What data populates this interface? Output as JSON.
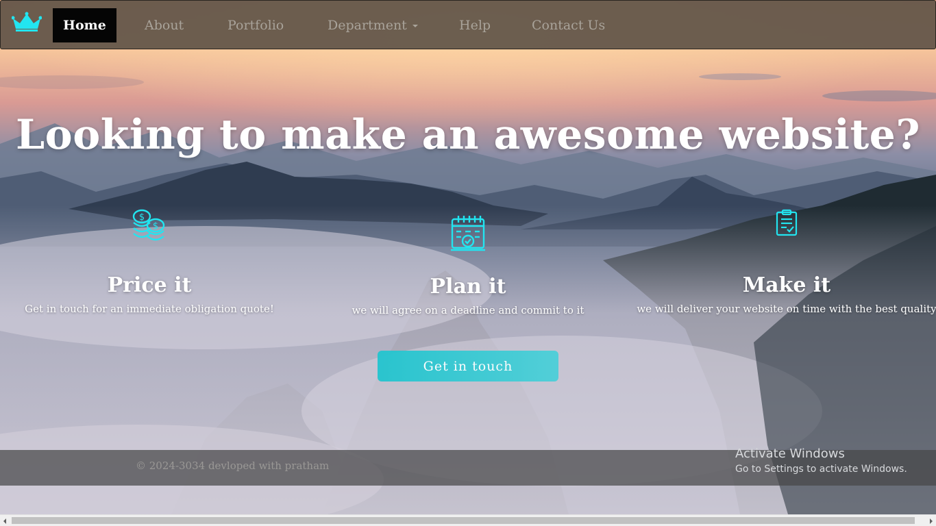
{
  "nav": {
    "brand_icon": "crown-icon",
    "items": [
      {
        "label": "Home",
        "active": true
      },
      {
        "label": "About"
      },
      {
        "label": "Portfolio"
      },
      {
        "label": "Department",
        "dropdown": true
      },
      {
        "label": "Help"
      },
      {
        "label": "Contact Us"
      }
    ]
  },
  "hero": {
    "title": "Looking to make an awesome website?",
    "features": [
      {
        "icon": "coins-icon",
        "title": "Price it",
        "text": "Get in touch for an immediate obligation quote!"
      },
      {
        "icon": "calendar-icon",
        "title": "Plan it",
        "text": "we will agree on a deadline and commit to it"
      },
      {
        "icon": "clipboard-check-icon",
        "title": "Make it",
        "text": "we will deliver your website on time with the best quality"
      }
    ],
    "cta_label": "Get in touch"
  },
  "footer": {
    "text": "© 2024-3034 devloped with pratham"
  },
  "watermark": {
    "line1": "Activate Windows",
    "line2": "Go to Settings to activate Windows."
  },
  "colors": {
    "accent": "#22d3dc",
    "nav_bg": "#605448",
    "active_nav_bg": "#050505"
  }
}
